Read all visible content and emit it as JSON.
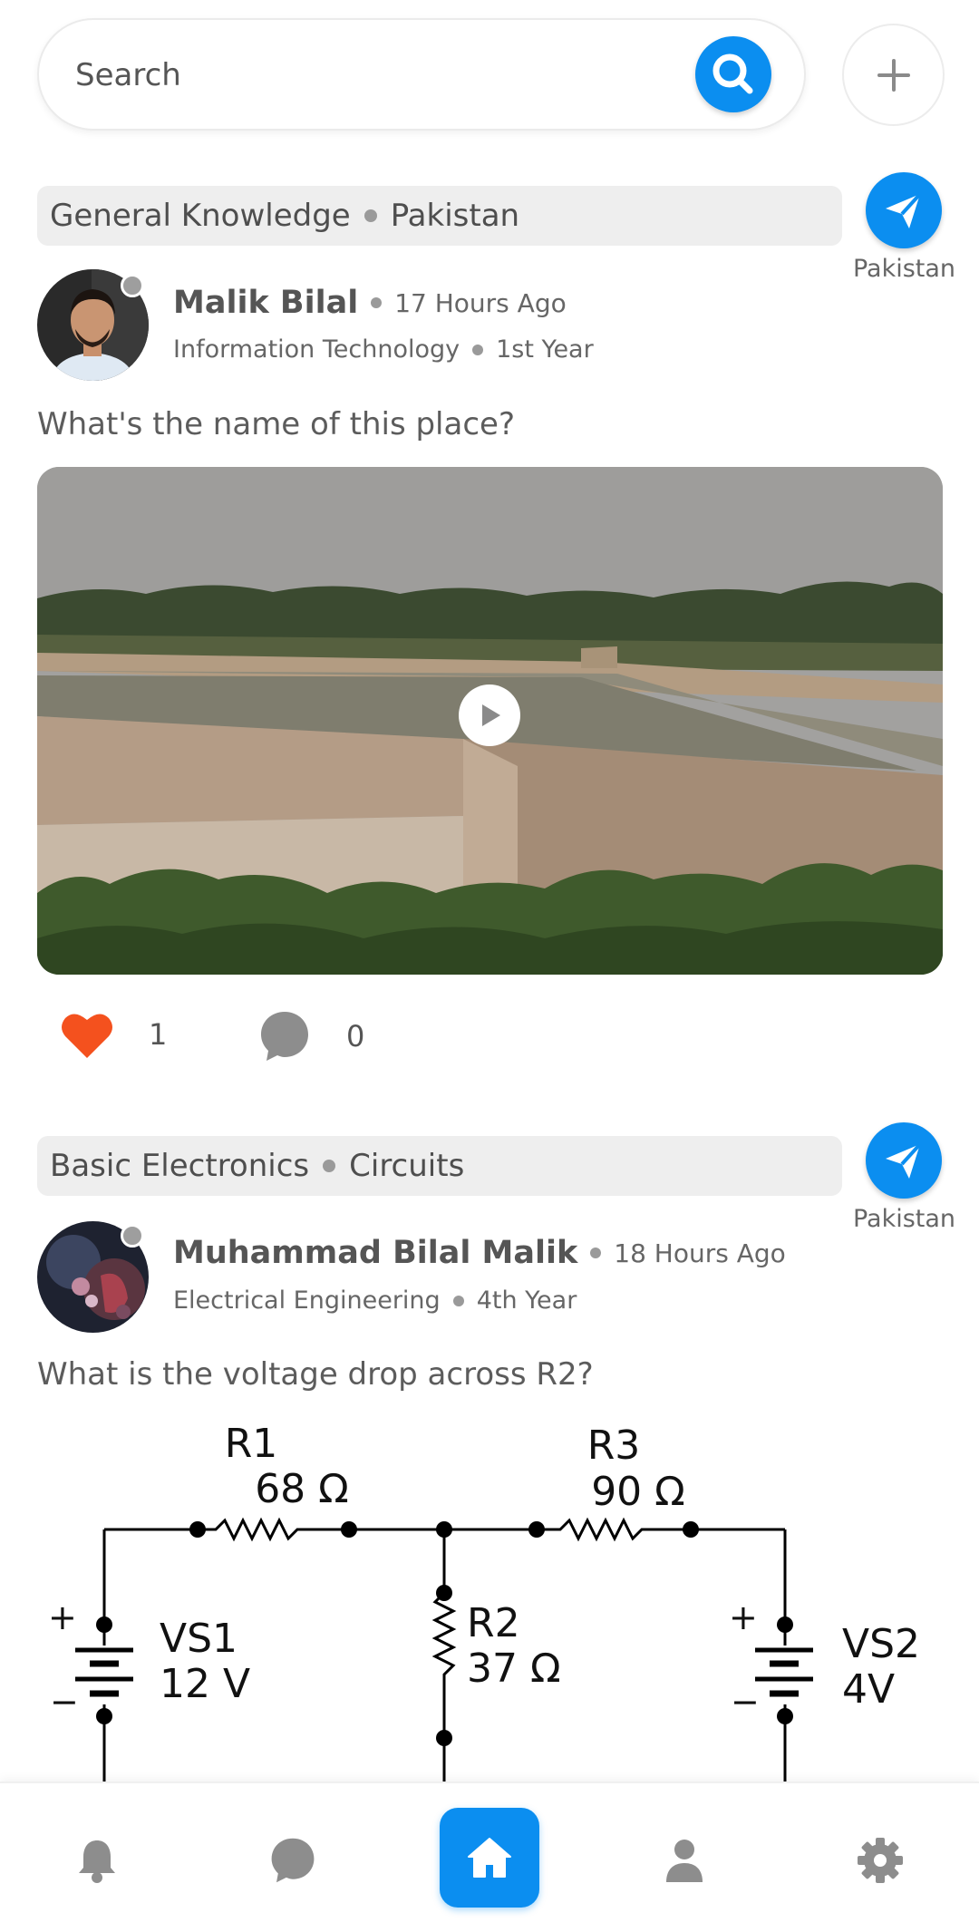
{
  "search": {
    "placeholder": "Search"
  },
  "colors": {
    "accent": "#0b8ef0",
    "heart": "#f4511e",
    "muted_icon": "#8d8d8d"
  },
  "posts": [
    {
      "subject": "General Knowledge",
      "topic": "Pakistan",
      "share_label": "Pakistan",
      "author": "Malik Bilal",
      "time": "17 Hours Ago",
      "department": "Information Technology",
      "year": "1st Year",
      "question": "What's the name of this place?",
      "media": {
        "type": "video",
        "icon": "play-icon"
      },
      "likes": "1",
      "comments": "0"
    },
    {
      "subject": "Basic Electronics",
      "topic": "Circuits",
      "share_label": "Pakistan",
      "author": "Muhammad Bilal Malik",
      "time": "18 Hours Ago",
      "department": "Electrical Engineering",
      "year": "4th Year",
      "question": "What is the voltage drop across R2?",
      "circuit": {
        "r1_name": "R1",
        "r1_value": "68 Ω",
        "r3_name": "R3",
        "r3_value": "90 Ω",
        "r2_name": "R2",
        "r2_value": "37 Ω",
        "vs1_name": "VS1",
        "vs1_value": "12 V",
        "vs2_name": "VS2",
        "vs2_value": "4V",
        "plus": "+",
        "minus": "−"
      }
    }
  ],
  "nav": {
    "items": [
      {
        "icon": "bell-icon"
      },
      {
        "icon": "chat-icon"
      },
      {
        "icon": "home-icon",
        "active": true
      },
      {
        "icon": "user-icon"
      },
      {
        "icon": "gear-icon"
      }
    ]
  }
}
